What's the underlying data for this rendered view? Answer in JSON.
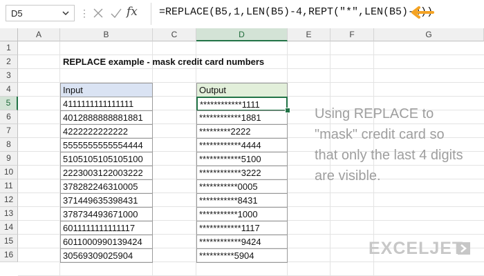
{
  "formula_bar": {
    "name_box": "D5",
    "fx_label": "fx",
    "formula": "=REPLACE(B5,1,LEN(B5)-4,REPT(\"*\",LEN(B5)-4))"
  },
  "columns": [
    "A",
    "B",
    "C",
    "D",
    "E",
    "F",
    "G"
  ],
  "rows": [
    "1",
    "2",
    "3",
    "4",
    "5",
    "6",
    "7",
    "8",
    "9",
    "10",
    "11",
    "12",
    "13",
    "14",
    "15",
    "16"
  ],
  "sheet": {
    "title": "REPLACE example - mask credit card numbers",
    "input_header": "Input",
    "output_header": "Output",
    "inputs": [
      "4111111111111111",
      "4012888888881881",
      "4222222222222",
      "5555555555554444",
      "5105105105105100",
      "2223003122003222",
      "378282246310005",
      "371449635398431",
      "378734493671000",
      "6011111111111117",
      "6011000990139424",
      "30569309025904"
    ],
    "outputs": [
      "************1111",
      "************1881",
      "*********2222",
      "************4444",
      "************5100",
      "************3222",
      "***********0005",
      "***********8431",
      "***********1000",
      "************1117",
      "************9424",
      "**********5904"
    ],
    "note": "Using REPLACE to \"mask\" credit card so that only the last 4 digits are visible."
  },
  "branding": {
    "logo_text": "EXCELJET"
  },
  "colors": {
    "input_header_bg": "#dae3f3",
    "output_header_bg": "#e2efda",
    "selection": "#217346",
    "arrow": "#f4a324"
  }
}
